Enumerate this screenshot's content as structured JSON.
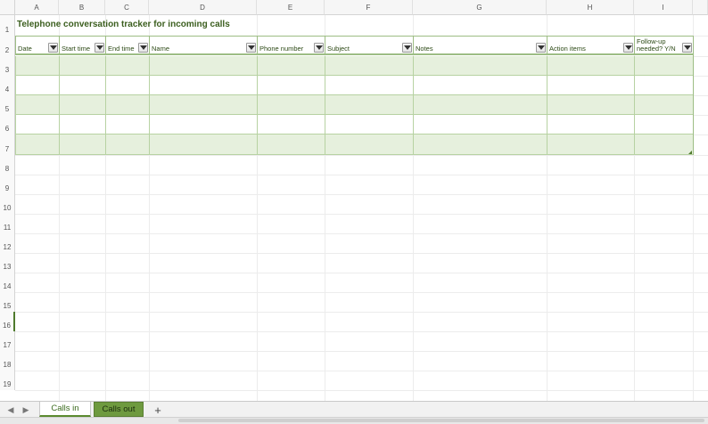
{
  "columns": [
    "A",
    "B",
    "C",
    "D",
    "E",
    "F",
    "G",
    "H",
    "I"
  ],
  "rows": [
    "1",
    "2",
    "3",
    "4",
    "5",
    "6",
    "7",
    "8",
    "9",
    "10",
    "11",
    "12",
    "13",
    "14",
    "15",
    "16",
    "17",
    "18",
    "19"
  ],
  "active_row": "16",
  "title": "Telephone conversation tracker for incoming calls",
  "headers": [
    {
      "label": "Date"
    },
    {
      "label": "Start time"
    },
    {
      "label": "End time"
    },
    {
      "label": "Name"
    },
    {
      "label": "Phone number"
    },
    {
      "label": "Subject"
    },
    {
      "label": "Notes"
    },
    {
      "label": "Action items"
    },
    {
      "label": "Follow-up needed? Y/N"
    }
  ],
  "tabs": [
    {
      "label": "Calls in",
      "active": true
    },
    {
      "label": "Calls out",
      "active": false
    }
  ],
  "add_tab": "+",
  "nav": {
    "prev": "◀",
    "next": "▶"
  },
  "colors": {
    "accent": "#5b8a2f",
    "band": "#e6f0dd",
    "header_border": "#9dbd84",
    "title": "#3b5e1e"
  }
}
